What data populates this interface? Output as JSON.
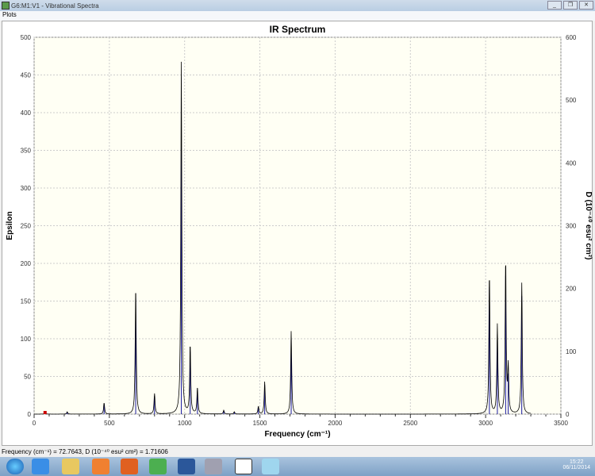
{
  "window": {
    "title": "G6:M1:V1 - Vibrational Spectra",
    "menu": "Plots"
  },
  "status": "Frequency (cm⁻¹) = 72.7643, D (10⁻⁴⁰ esu² cm²) = 1.71606",
  "clock": {
    "time": "15:22",
    "date": "06/11/2014"
  },
  "taskbar": [
    "start",
    "internet-explorer",
    "file-explorer",
    "media-player",
    "firefox",
    "chrome",
    "word",
    "gaussview-search",
    "gaussian",
    "notepad"
  ],
  "chart_data": {
    "type": "line",
    "title": "IR Spectrum",
    "xlabel": "Frequency (cm⁻¹)",
    "ylabel": "Epsilon",
    "y2label": "D (10⁻⁴⁰ esu² cm²)",
    "xlim": [
      0,
      3500
    ],
    "ylim": [
      0,
      500
    ],
    "y2lim": [
      0,
      600
    ],
    "xticks": [
      0,
      500,
      1000,
      1500,
      2000,
      2500,
      3000,
      3500
    ],
    "yticks": [
      0,
      50,
      100,
      150,
      200,
      250,
      300,
      350,
      400,
      450,
      500
    ],
    "y2ticks": [
      0,
      100,
      200,
      300,
      400,
      500,
      600
    ],
    "grid": true,
    "colors": {
      "spectrum": "#000000",
      "sticks": "#1a1aa0",
      "marker": "#cc0000",
      "background": "#fffff4"
    },
    "peaks": [
      {
        "freq": 73,
        "eps": 2
      },
      {
        "freq": 220,
        "eps": 3
      },
      {
        "freq": 465,
        "eps": 15
      },
      {
        "freq": 675,
        "eps": 170
      },
      {
        "freq": 800,
        "eps": 27
      },
      {
        "freq": 978,
        "eps": 467
      },
      {
        "freq": 1037,
        "eps": 92
      },
      {
        "freq": 1085,
        "eps": 35
      },
      {
        "freq": 1260,
        "eps": 5
      },
      {
        "freq": 1330,
        "eps": 3
      },
      {
        "freq": 1490,
        "eps": 10
      },
      {
        "freq": 1532,
        "eps": 43
      },
      {
        "freq": 1708,
        "eps": 110
      },
      {
        "freq": 3025,
        "eps": 187
      },
      {
        "freq": 3078,
        "eps": 118
      },
      {
        "freq": 3133,
        "eps": 204
      },
      {
        "freq": 3150,
        "eps": 60
      },
      {
        "freq": 3240,
        "eps": 174
      }
    ],
    "selected_point": {
      "freq": 72.7643,
      "D": 1.71606
    }
  }
}
